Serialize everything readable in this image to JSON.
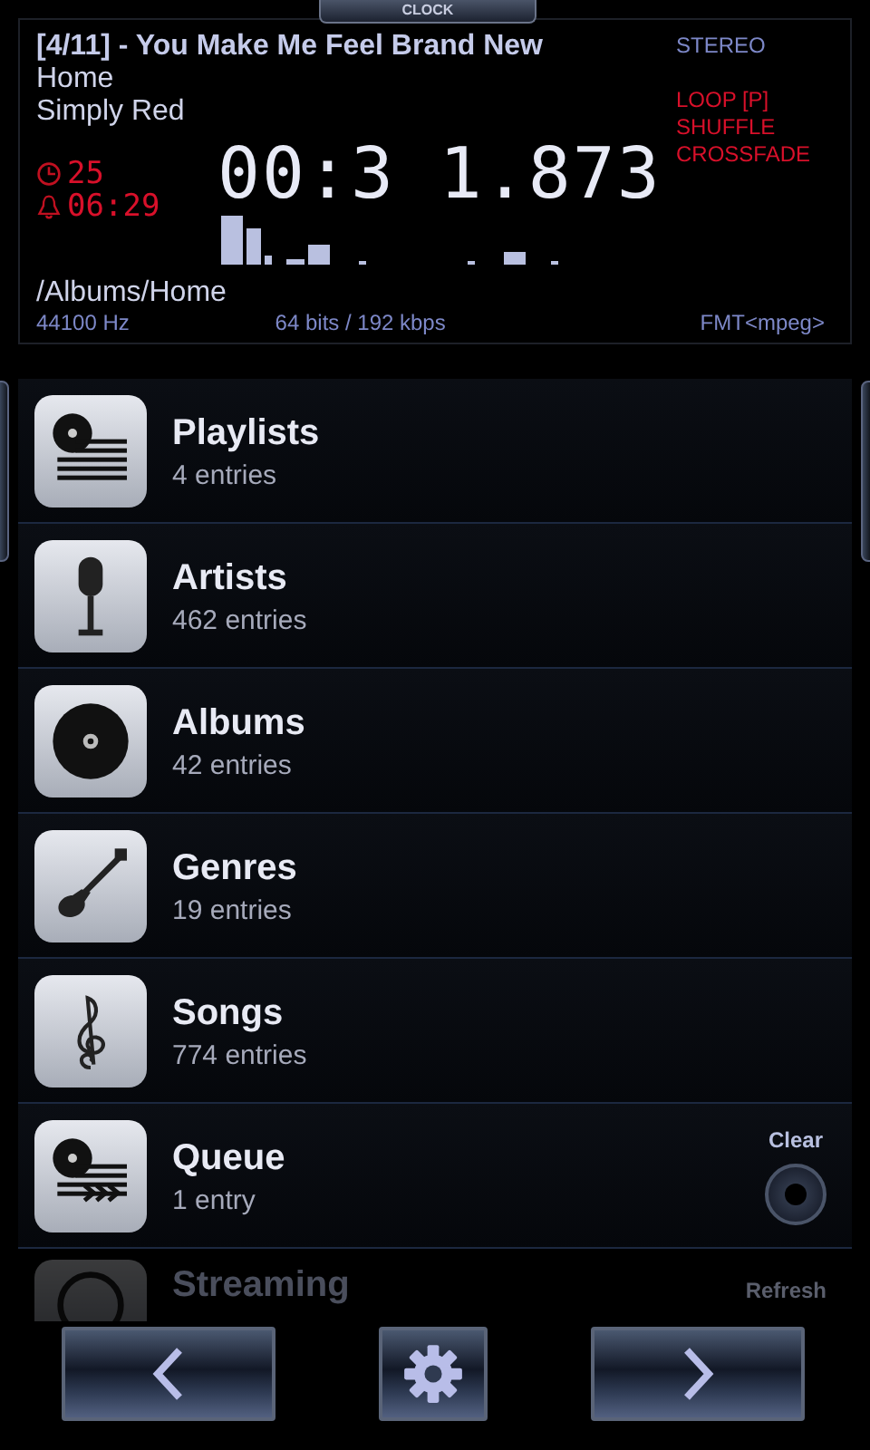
{
  "clock_tab": "CLOCK",
  "now_playing": {
    "track_title": "[4/11] - You Make Me Feel Brand New",
    "album": "Home",
    "artist": "Simply Red",
    "sleep_timer": "25",
    "alarm": "06:29",
    "position": "00:3 1.873",
    "path": "/Albums/Home",
    "sample_rate": "44100 Hz",
    "bitrate": "64 bits / 192 kbps",
    "channels": "STEREO",
    "modes": [
      "LOOP [P]",
      "SHUFFLE",
      "CROSSFADE"
    ],
    "format": "FMT<mpeg>"
  },
  "library": [
    {
      "kind": "playlists",
      "title": "Playlists",
      "count": "4 entries",
      "dimmed": false
    },
    {
      "kind": "artists",
      "title": "Artists",
      "count": "462 entries",
      "dimmed": false
    },
    {
      "kind": "albums",
      "title": "Albums",
      "count": "42 entries",
      "dimmed": false
    },
    {
      "kind": "genres",
      "title": "Genres",
      "count": "19 entries",
      "dimmed": false
    },
    {
      "kind": "songs",
      "title": "Songs",
      "count": "774 entries",
      "dimmed": false
    },
    {
      "kind": "queue",
      "title": "Queue",
      "count": "1 entry",
      "action": "Clear",
      "dimmed": false
    },
    {
      "kind": "streaming",
      "title": "Streaming",
      "action": "Refresh",
      "dimmed": true
    }
  ]
}
